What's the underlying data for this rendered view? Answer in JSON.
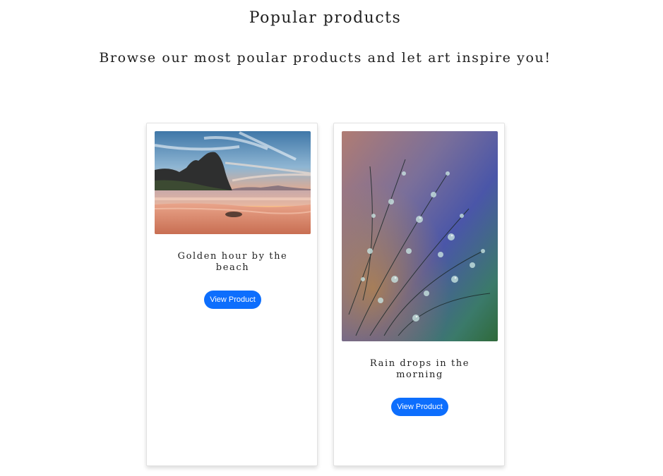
{
  "header": {
    "title": "Popular products",
    "subtitle": "Browse our most poular products and let art inspire you!"
  },
  "products": [
    {
      "title": "Golden hour by the beach",
      "button_label": "View Product",
      "image": "beach-sunset-photo"
    },
    {
      "title": "Rain drops in the morning",
      "button_label": "View Product",
      "image": "rain-drops-photo"
    }
  ],
  "colors": {
    "button": "#0d6efd",
    "button_text": "#ffffff",
    "text": "#1f1f1f"
  }
}
